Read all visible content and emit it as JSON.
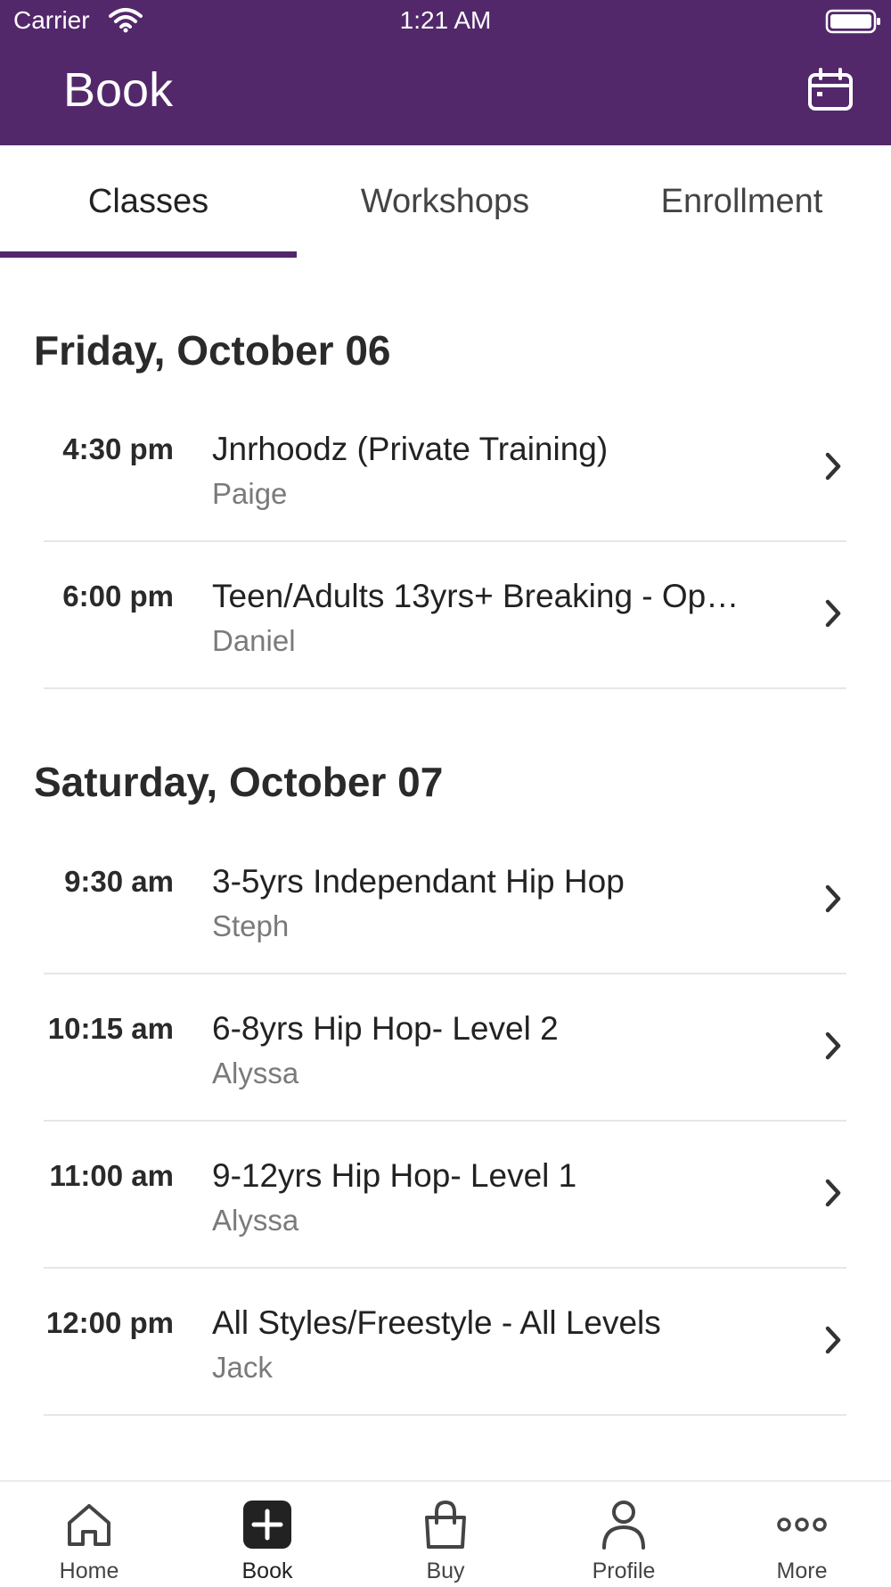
{
  "status_bar": {
    "carrier": "Carrier",
    "time": "1:21 AM"
  },
  "header": {
    "title": "Book",
    "calendar_icon": "calendar-icon"
  },
  "tabs": [
    {
      "label": "Classes",
      "active": true
    },
    {
      "label": "Workshops",
      "active": false
    },
    {
      "label": "Enrollment",
      "active": false
    }
  ],
  "days": [
    {
      "heading": "Friday, October 06",
      "classes": [
        {
          "time": "4:30 pm",
          "title": "Jnrhoodz (Private Training)",
          "instructor": "Paige"
        },
        {
          "time": "6:00 pm",
          "title": "Teen/Adults 13yrs+ Breaking - Ope…",
          "instructor": "Daniel"
        }
      ]
    },
    {
      "heading": "Saturday, October 07",
      "classes": [
        {
          "time": "9:30 am",
          "title": "3-5yrs Independant Hip Hop",
          "instructor": "Steph"
        },
        {
          "time": "10:15 am",
          "title": "6-8yrs Hip Hop- Level 2",
          "instructor": "Alyssa"
        },
        {
          "time": "11:00 am",
          "title": "9-12yrs Hip Hop- Level 1",
          "instructor": "Alyssa"
        },
        {
          "time": "12:00 pm",
          "title": "All Styles/Freestyle - All Levels",
          "instructor": "Jack"
        }
      ]
    }
  ],
  "tabbar": [
    {
      "label": "Home",
      "icon": "home-icon",
      "active": false
    },
    {
      "label": "Book",
      "icon": "plus-square-icon",
      "active": true
    },
    {
      "label": "Buy",
      "icon": "shopping-bag-icon",
      "active": false
    },
    {
      "label": "Profile",
      "icon": "person-icon",
      "active": false
    },
    {
      "label": "More",
      "icon": "more-dots-icon",
      "active": false
    }
  ],
  "colors": {
    "brand": "#52286b",
    "background": "#ffffff",
    "divider": "#e6e6e6",
    "secondary_text": "#7a7a7a"
  }
}
